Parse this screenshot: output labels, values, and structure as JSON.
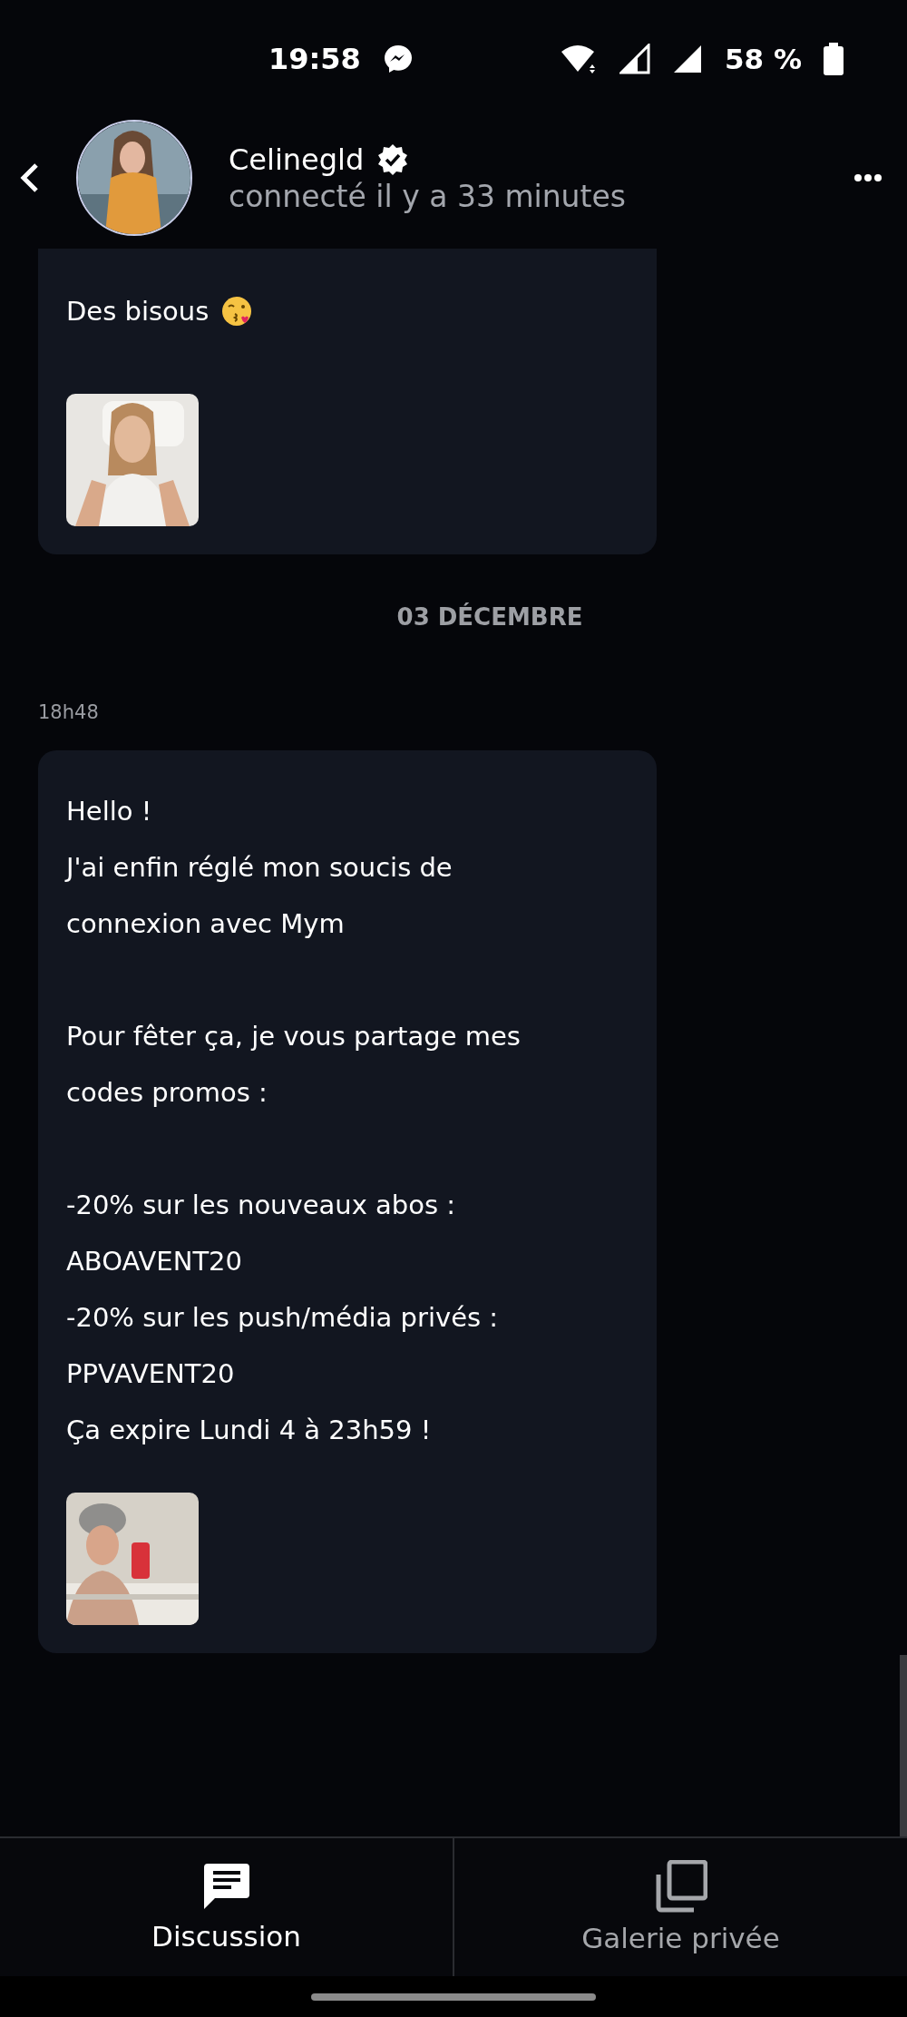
{
  "status_bar": {
    "time": "19:58",
    "battery": "58 %"
  },
  "header": {
    "name": "Celinegld",
    "verified": true,
    "presence": "connecté il y a 33 minutes"
  },
  "messages": [
    {
      "kind": "message",
      "text": "Des bisous",
      "emoji": true
    },
    {
      "kind": "date",
      "text": "03 DÉCEMBRE"
    },
    {
      "kind": "time",
      "text": "18h48"
    },
    {
      "kind": "message",
      "text": "Hello !\nJ'ai enfin réglé mon soucis de\nconnexion avec Mym\n\nPour fêter ça, je vous partage mes\ncodes promos :\n\n-20% sur les nouveaux abos :\nABOAVENT20\n-20% sur les push/média privés :\nPPVAVENT20\nÇa expire Lundi 4 à 23h59 !",
      "emoji": false
    }
  ],
  "tabs": [
    {
      "label": "Discussion",
      "selected": true,
      "kind": "chat"
    },
    {
      "label": "Galerie privée",
      "selected": false,
      "kind": "gallery"
    }
  ]
}
